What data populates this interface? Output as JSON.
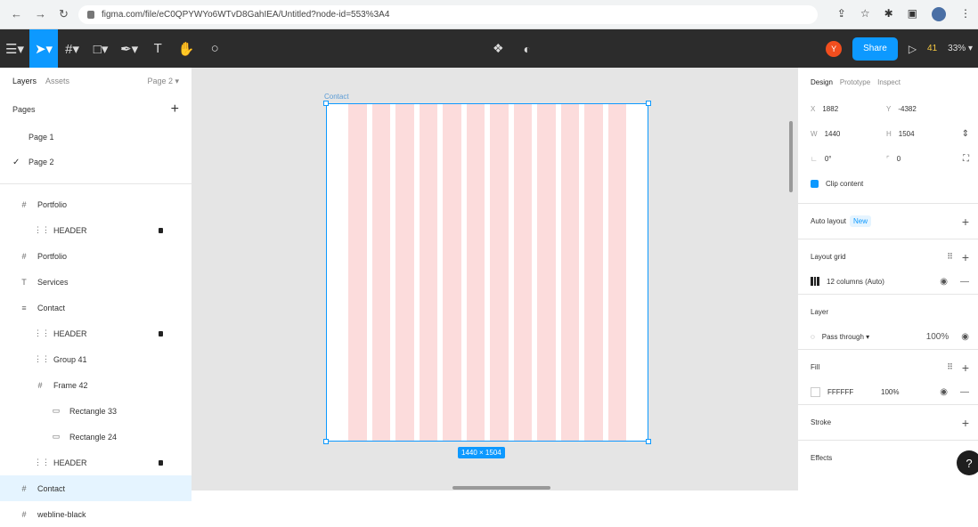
{
  "browser": {
    "url": "figma.com/file/eC0QPYWYo6WTvD8GahIEA/Untitled?node-id=553%3A4"
  },
  "toolbar": {
    "user_initial": "Y",
    "share_label": "Share",
    "count": "41",
    "zoom": "33%"
  },
  "left_panel": {
    "tab_layers": "Layers",
    "tab_assets": "Assets",
    "page_selector": "Page 2",
    "pages_heading": "Pages",
    "pages": [
      {
        "label": "Page 1",
        "selected": false
      },
      {
        "label": "Page 2",
        "selected": true
      }
    ],
    "layers": [
      {
        "label": "Portfolio",
        "icon": "frame-icon",
        "indent": 0,
        "locked": false,
        "selected": false
      },
      {
        "label": "HEADER",
        "icon": "group-icon",
        "indent": 1,
        "locked": true,
        "selected": false
      },
      {
        "label": "Portfolio",
        "icon": "frame-icon",
        "indent": 0,
        "locked": false,
        "selected": false
      },
      {
        "label": "Services",
        "icon": "text-icon",
        "indent": 0,
        "locked": false,
        "selected": false
      },
      {
        "label": "Contact",
        "icon": "layout-icon",
        "indent": 0,
        "locked": false,
        "selected": false
      },
      {
        "label": "HEADER",
        "icon": "group-icon",
        "indent": 1,
        "locked": true,
        "selected": false
      },
      {
        "label": "Group 41",
        "icon": "group-icon",
        "indent": 1,
        "locked": false,
        "selected": false
      },
      {
        "label": "Frame 42",
        "icon": "frame-icon",
        "indent": 1,
        "locked": false,
        "selected": false
      },
      {
        "label": "Rectangle 33",
        "icon": "rect-icon",
        "indent": 2,
        "locked": false,
        "selected": false
      },
      {
        "label": "Rectangle 24",
        "icon": "rect-icon",
        "indent": 2,
        "locked": false,
        "selected": false
      },
      {
        "label": "HEADER",
        "icon": "group-icon",
        "indent": 1,
        "locked": true,
        "selected": false
      },
      {
        "label": "Contact",
        "icon": "frame-icon",
        "indent": 0,
        "locked": false,
        "selected": true
      },
      {
        "label": "webline-black",
        "icon": "frame-icon",
        "indent": 0,
        "locked": false,
        "selected": false
      }
    ]
  },
  "canvas": {
    "frame_name": "Contact",
    "dimensions": "1440 × 1504",
    "column_count": 12
  },
  "right_panel": {
    "tab_design": "Design",
    "tab_prototype": "Prototype",
    "tab_inspect": "Inspect",
    "x_label": "X",
    "x_value": "1882",
    "y_label": "Y",
    "y_value": "-4382",
    "w_label": "W",
    "w_value": "1440",
    "h_label": "H",
    "h_value": "1504",
    "rotation": "0°",
    "radius": "0",
    "clip_content": "Clip content",
    "auto_layout": "Auto layout",
    "new_badge": "New",
    "layout_grid": "Layout grid",
    "grid_item": "12 columns (Auto)",
    "layer": "Layer",
    "blend_mode": "Pass through",
    "opacity": "100%",
    "fill": "Fill",
    "fill_hex": "FFFFFF",
    "fill_opacity": "100%",
    "stroke": "Stroke",
    "effects": "Effects",
    "help": "?"
  }
}
